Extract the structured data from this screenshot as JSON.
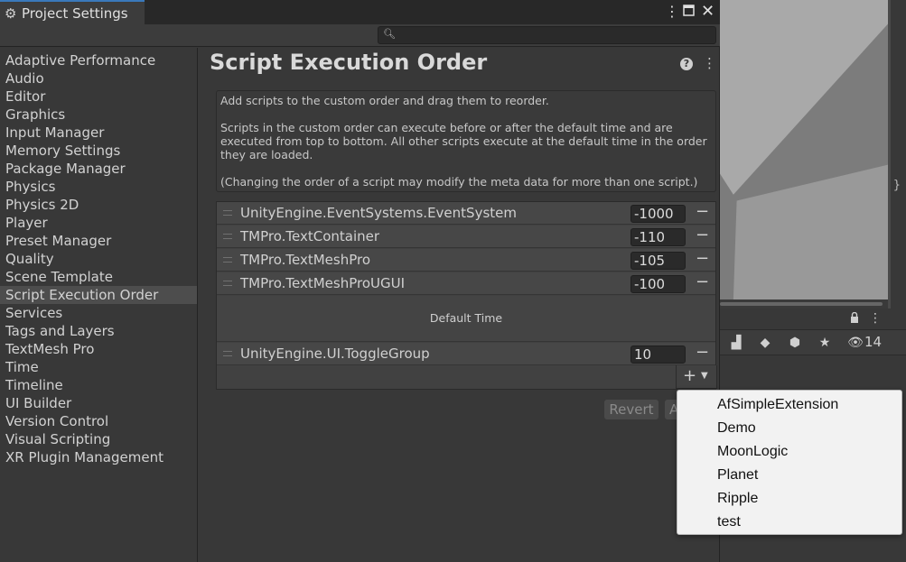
{
  "window": {
    "tab_title": "Project Settings",
    "search_placeholder": ""
  },
  "sidebar": {
    "items": [
      "Adaptive Performance",
      "Audio",
      "Editor",
      "Graphics",
      "Input Manager",
      "Memory Settings",
      "Package Manager",
      "Physics",
      "Physics 2D",
      "Player",
      "Preset Manager",
      "Quality",
      "Scene Template",
      "Script Execution Order",
      "Services",
      "Tags and Layers",
      "TextMesh Pro",
      "Time",
      "Timeline",
      "UI Builder",
      "Version Control",
      "Visual Scripting",
      "XR Plugin Management"
    ],
    "selected": "Script Execution Order"
  },
  "main": {
    "title": "Script Execution Order",
    "info": {
      "line1": "Add scripts to the custom order and drag them to reorder.",
      "line2": "Scripts in the custom order can execute before or after the default time and are",
      "line3": "executed from top to bottom. All other scripts execute at the default time in the order",
      "line4": "they are loaded.",
      "line5": "(Changing the order of a script may modify the meta data for more than one script.)"
    },
    "scripts_before": [
      {
        "name": "UnityEngine.EventSystems.EventSystem",
        "order": "-1000"
      },
      {
        "name": "TMPro.TextContainer",
        "order": "-110"
      },
      {
        "name": "TMPro.TextMeshPro",
        "order": "-105"
      },
      {
        "name": "TMPro.TextMeshProUGUI",
        "order": "-100"
      }
    ],
    "default_time_label": "Default Time",
    "scripts_after": [
      {
        "name": "UnityEngine.UI.ToggleGroup",
        "order": "10"
      }
    ],
    "revert_label": "Revert",
    "apply_label": "A"
  },
  "dropdown": {
    "items": [
      "AfSimpleExtension",
      "Demo",
      "MoonLogic",
      "Planet",
      "Ripple",
      "test"
    ]
  },
  "background_panel": {
    "visible_count": "14"
  }
}
